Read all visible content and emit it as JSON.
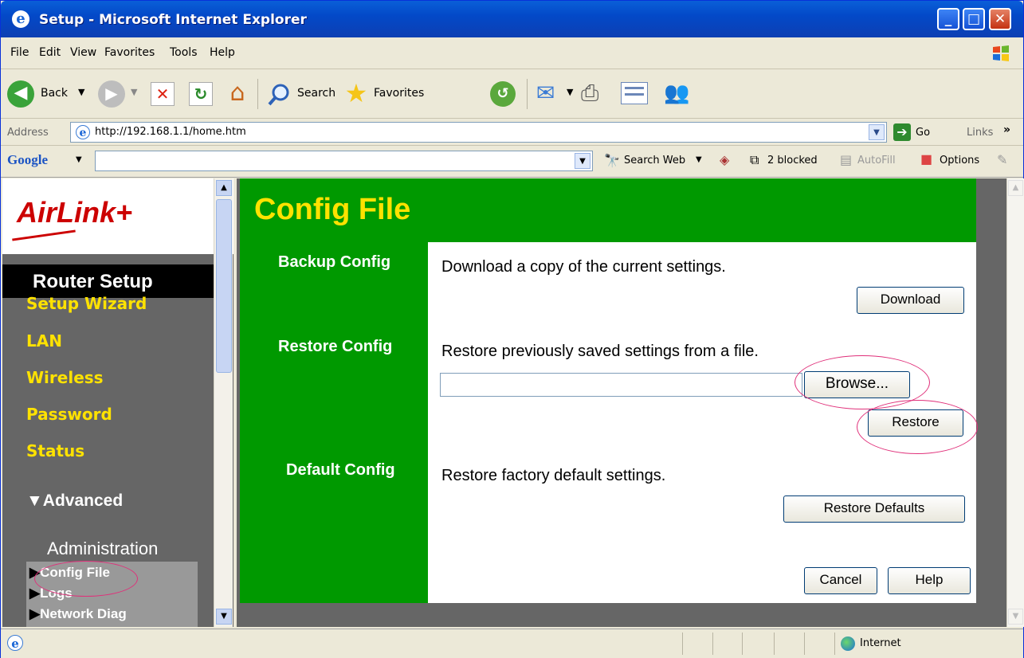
{
  "window": {
    "title": "Setup - Microsoft Internet Explorer"
  },
  "menu": [
    "File",
    "Edit",
    "View",
    "Favorites",
    "Tools",
    "Help"
  ],
  "toolbar": {
    "back": "Back",
    "search": "Search",
    "favorites": "Favorites"
  },
  "address": {
    "label": "Address",
    "url": "http://192.168.1.1/home.htm",
    "go": "Go",
    "links": "Links"
  },
  "google": {
    "logo": "Google",
    "search_web": "Search Web",
    "blocked": "2 blocked",
    "autofill": "AutoFill",
    "options": "Options"
  },
  "sidebar": {
    "logo": "AirLink+",
    "header": "Router Setup",
    "items": [
      "Setup Wizard",
      "LAN",
      "Wireless",
      "Password",
      "Status"
    ],
    "advanced": "Advanced",
    "section": "Administration",
    "subitems": [
      "Config File",
      "Logs",
      "Network Diag"
    ]
  },
  "main": {
    "title": "Config File",
    "backup": {
      "label": "Backup Config",
      "desc": "Download a copy of the current settings.",
      "button": "Download"
    },
    "restore": {
      "label": "Restore Config",
      "desc": "Restore previously saved settings from a file.",
      "file_value": "",
      "browse": "Browse...",
      "button": "Restore"
    },
    "default": {
      "label": "Default Config",
      "desc": "Restore factory default settings.",
      "button": "Restore Defaults"
    },
    "cancel": "Cancel",
    "help": "Help"
  },
  "status": {
    "zone": "Internet"
  },
  "colors": {
    "green": "#009900",
    "yellow": "#ffe200",
    "sidebar_bg": "#666666",
    "highlight": "#e0307a"
  }
}
